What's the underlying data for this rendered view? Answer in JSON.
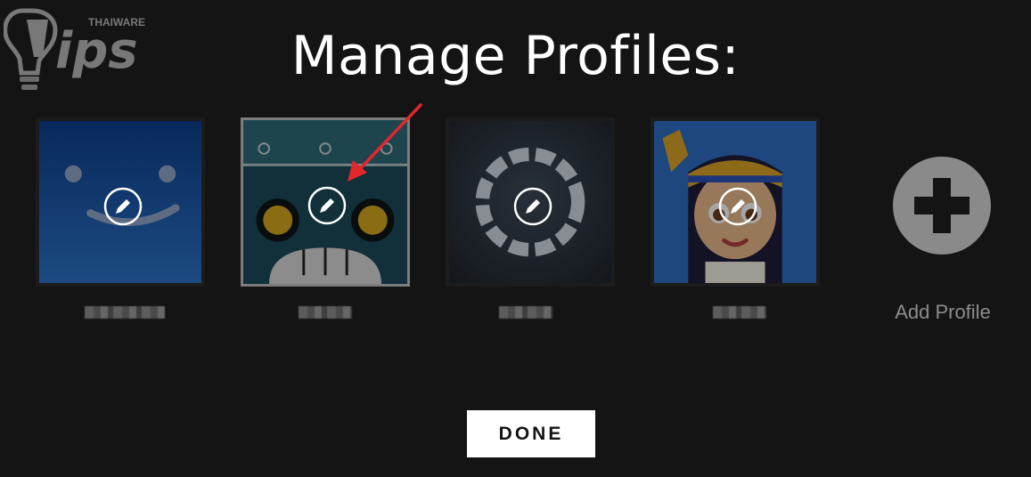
{
  "page": {
    "title": "Manage Profiles:"
  },
  "watermark": {
    "brand_small": "THAIWARE",
    "brand_large": "Tips"
  },
  "profiles": [
    {
      "avatar": "smiley-face-avatar",
      "name": "",
      "selected": false,
      "edit_icon": "pencil-icon"
    },
    {
      "avatar": "robot-face-avatar",
      "name": "",
      "selected": true,
      "edit_icon": "pencil-icon"
    },
    {
      "avatar": "glowing-ring-avatar",
      "name": "",
      "selected": false,
      "edit_icon": "pencil-icon"
    },
    {
      "avatar": "egyptian-girl-avatar",
      "name": "",
      "selected": false,
      "edit_icon": "pencil-icon"
    }
  ],
  "add_profile": {
    "label": "Add Profile",
    "icon": "plus-circle-icon"
  },
  "actions": {
    "done_label": "DONE"
  },
  "annotation": {
    "icon": "red-arrow-icon",
    "color": "#e3262b"
  },
  "colors": {
    "background": "#141414",
    "title": "#ffffff",
    "muted_text": "#8c8c8c",
    "done_bg": "#ffffff"
  }
}
